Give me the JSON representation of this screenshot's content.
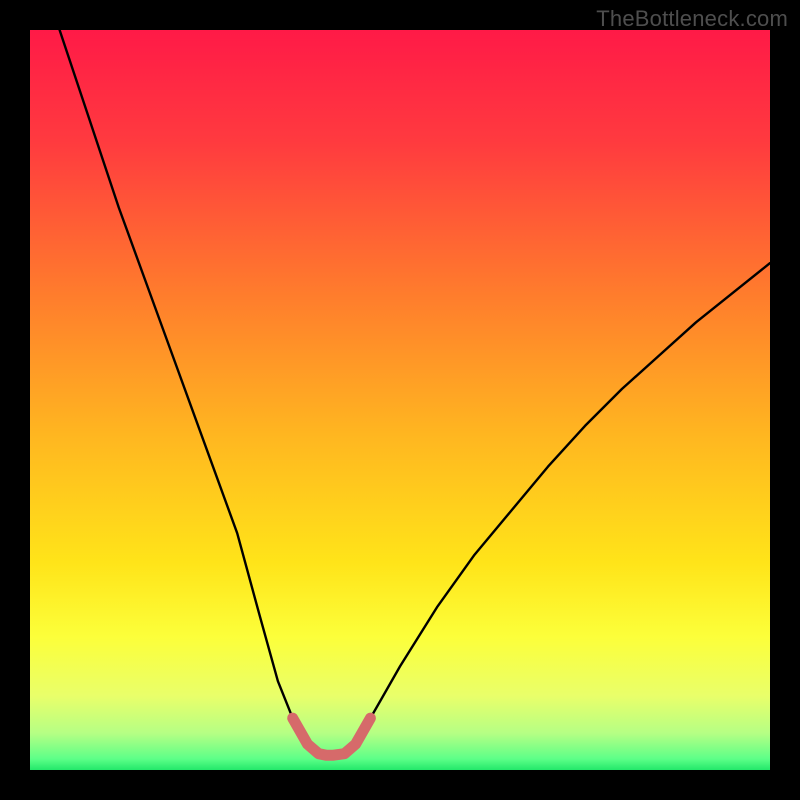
{
  "watermark": "TheBottleneck.com",
  "colors": {
    "frame": "#000000",
    "curve_stroke": "#000000",
    "marker_stroke": "#d66a6a",
    "gradient_stops": [
      {
        "offset": 0.0,
        "color": "#ff1a47"
      },
      {
        "offset": 0.15,
        "color": "#ff3a3f"
      },
      {
        "offset": 0.35,
        "color": "#ff7a2d"
      },
      {
        "offset": 0.55,
        "color": "#ffb720"
      },
      {
        "offset": 0.72,
        "color": "#ffe419"
      },
      {
        "offset": 0.82,
        "color": "#fcff3a"
      },
      {
        "offset": 0.9,
        "color": "#e9ff6a"
      },
      {
        "offset": 0.95,
        "color": "#b6ff84"
      },
      {
        "offset": 0.985,
        "color": "#5dff88"
      },
      {
        "offset": 1.0,
        "color": "#23e86a"
      }
    ]
  },
  "chart_data": {
    "type": "line",
    "title": "",
    "xlabel": "",
    "ylabel": "",
    "xlim": [
      0,
      100
    ],
    "ylim": [
      0,
      100
    ],
    "grid": false,
    "legend": false,
    "annotations": [],
    "series": [
      {
        "name": "curve",
        "x": [
          4,
          8,
          12,
          16,
          20,
          24,
          28,
          31,
          33.5,
          35.5,
          37.5,
          39,
          40,
          41,
          42.5,
          44,
          46,
          50,
          55,
          60,
          65,
          70,
          75,
          80,
          85,
          90,
          95,
          100
        ],
        "values": [
          100,
          88,
          76,
          65,
          54,
          43,
          32,
          21,
          12,
          7,
          3.5,
          2.2,
          2.0,
          2.0,
          2.2,
          3.5,
          7,
          14,
          22,
          29,
          35,
          41,
          46.5,
          51.5,
          56,
          60.5,
          64.5,
          68.5
        ]
      },
      {
        "name": "highlight-valley",
        "x": [
          35.5,
          37.5,
          39,
          40,
          41,
          42.5,
          44,
          46
        ],
        "values": [
          7,
          3.5,
          2.2,
          2.0,
          2.0,
          2.2,
          3.5,
          7
        ]
      }
    ]
  }
}
